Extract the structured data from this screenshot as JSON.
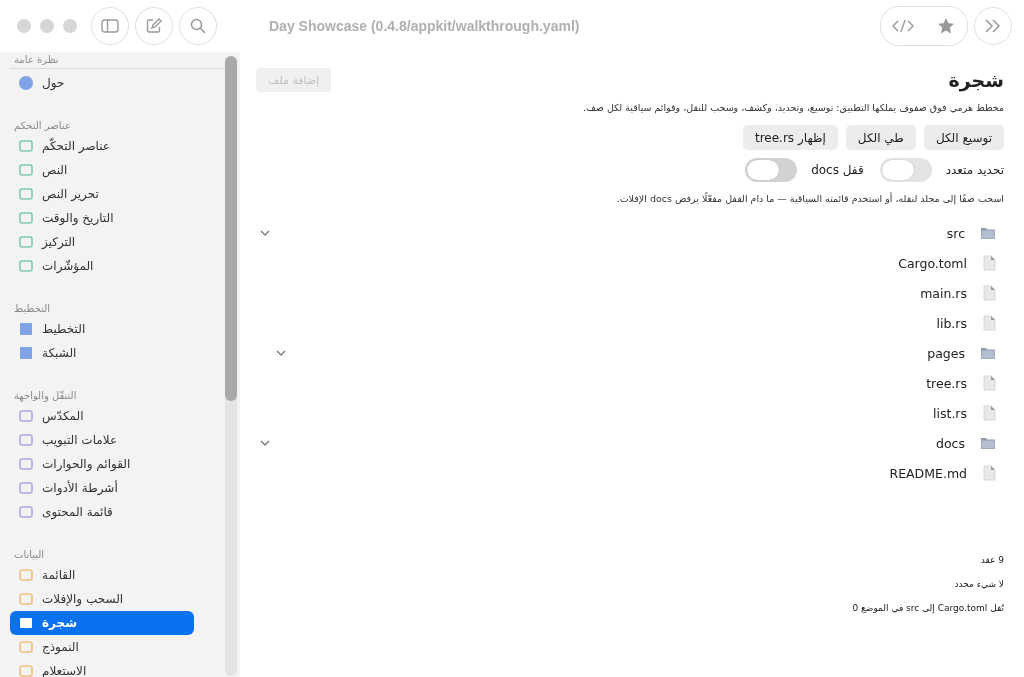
{
  "window": {
    "title": "Day Showcase (0.4.8/appkit/walkthrough.yaml)"
  },
  "sidebar": {
    "sections": [
      {
        "title": "نظرة عامة",
        "items": [
          {
            "label": "حول",
            "selected": false
          }
        ]
      },
      {
        "title": "عناصر التحكم",
        "items": [
          {
            "label": "عناصر التحكّم",
            "selected": false
          },
          {
            "label": "النص",
            "selected": false
          },
          {
            "label": "تحرير النص",
            "selected": false
          },
          {
            "label": "التاريخ والوقت",
            "selected": false
          },
          {
            "label": "التركيز",
            "selected": false
          },
          {
            "label": "المؤشّرات",
            "selected": false
          }
        ]
      },
      {
        "title": "التخطيط",
        "items": [
          {
            "label": "التخطيط",
            "selected": false
          },
          {
            "label": "الشبكة",
            "selected": false
          }
        ]
      },
      {
        "title": "التنقّل والواجهة",
        "items": [
          {
            "label": "المكدّس",
            "selected": false
          },
          {
            "label": "علامات التبويب",
            "selected": false
          },
          {
            "label": "القوائم والحوارات",
            "selected": false
          },
          {
            "label": "أشرطة الأدوات",
            "selected": false
          },
          {
            "label": "قائمة المحتوى",
            "selected": false
          }
        ]
      },
      {
        "title": "البيانات",
        "items": [
          {
            "label": "القائمة",
            "selected": false
          },
          {
            "label": "السحب والإفلات",
            "selected": false
          },
          {
            "label": "شجرة",
            "selected": true
          },
          {
            "label": "النموذج",
            "selected": false
          },
          {
            "label": "الاستعلام",
            "selected": false
          }
        ]
      }
    ]
  },
  "page": {
    "title": "شجرة",
    "add_button": {
      "label": "إضافة ملف",
      "disabled": true
    },
    "description": "مخطط هرمي فوق صفوف يملكها التطبيق: توسيع، وتحديد، وكشف، وسحب للنقل، وقوائم سياقية لكل صف.",
    "buttons": [
      "توسيع الكل",
      "طي الكل",
      "إظهار tree.rs"
    ],
    "toggles": [
      {
        "label": "تحديد متعدد",
        "on": false
      },
      {
        "label": "قفل docs",
        "on": false
      }
    ],
    "hint": "اسحب صفًا إلى مجلد لنقله، أو استخدم قائمته السياقية — ما دام القفل مفعّلًا يرفض docs الإفلات.",
    "tree": [
      {
        "name": "src",
        "kind": "folder",
        "expanded": true,
        "children": [
          {
            "name": "Cargo.toml",
            "kind": "file"
          },
          {
            "name": "main.rs",
            "kind": "file"
          },
          {
            "name": "lib.rs",
            "kind": "file"
          },
          {
            "name": "pages",
            "kind": "folder",
            "expanded": true,
            "children": [
              {
                "name": "tree.rs",
                "kind": "file"
              },
              {
                "name": "list.rs",
                "kind": "file"
              }
            ]
          }
        ]
      },
      {
        "name": "docs",
        "kind": "folder",
        "expanded": true,
        "children": [
          {
            "name": "README.md",
            "kind": "file"
          }
        ]
      }
    ],
    "status": [
      "9 عقد",
      "لا شيء محدد",
      "نُقل Cargo.toml إلى src في الموضع 0"
    ]
  }
}
